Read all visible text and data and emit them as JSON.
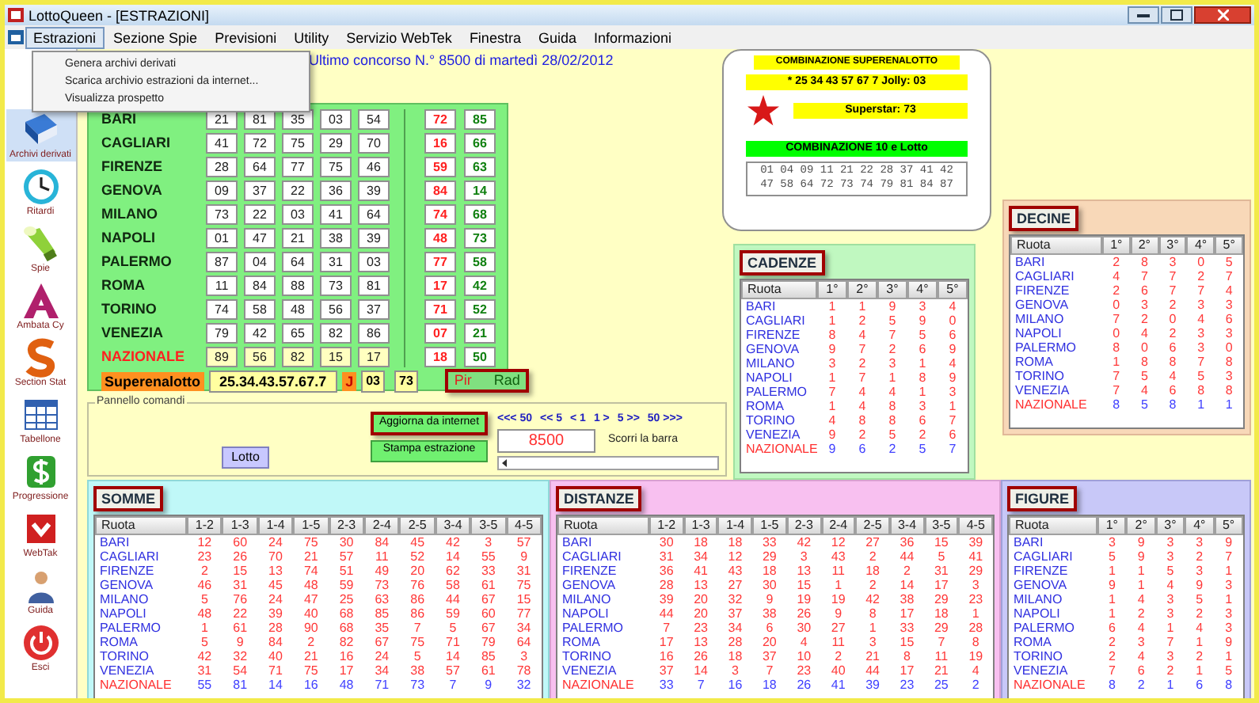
{
  "window": {
    "title": "LottoQueen - [ESTRAZIONI]"
  },
  "menu": [
    {
      "label": "Estrazioni",
      "selected": true
    },
    {
      "label": "Sezione Spie",
      "selected": false
    },
    {
      "label": "Previsioni",
      "selected": false
    },
    {
      "label": "Utility",
      "selected": false
    },
    {
      "label": "Servizio WebTek",
      "selected": false
    },
    {
      "label": "Finestra",
      "selected": false
    },
    {
      "label": "Guida",
      "selected": false
    },
    {
      "label": "Informazioni",
      "selected": false
    }
  ],
  "dropdown": [
    "Genera archivi derivati",
    "Scarica archivio estrazioni da internet...",
    "Visualizza prospetto"
  ],
  "sidebar": [
    {
      "label": "Archivi derivati",
      "kind": "book",
      "selected": true
    },
    {
      "label": "Ritardi",
      "kind": "clock",
      "selected": false
    },
    {
      "label": "Spie",
      "kind": "flashlight",
      "selected": false
    },
    {
      "label": "Ambata Cy",
      "kind": "triangle",
      "selected": false
    },
    {
      "label": "Section Stat",
      "kind": "curve",
      "selected": false
    },
    {
      "label": "Tabellone",
      "kind": "grid",
      "selected": false
    },
    {
      "label": "Progressione",
      "kind": "coin",
      "selected": false
    },
    {
      "label": "WebTak",
      "kind": "app",
      "selected": false
    },
    {
      "label": "Guida",
      "kind": "person",
      "selected": false
    },
    {
      "label": "Esci",
      "kind": "power",
      "selected": false
    }
  ],
  "heading": "Ultimo concorso N.° 8500 di martedì 28/02/2012",
  "wheels": [
    {
      "name": "BARI",
      "kind": "ruota",
      "numbers": [
        "21",
        "81",
        "35",
        "03",
        "54"
      ],
      "pir": "72",
      "rad": "85"
    },
    {
      "name": "CAGLIARI",
      "kind": "ruota",
      "numbers": [
        "41",
        "72",
        "75",
        "29",
        "70"
      ],
      "pir": "16",
      "rad": "66"
    },
    {
      "name": "FIRENZE",
      "kind": "ruota",
      "numbers": [
        "28",
        "64",
        "77",
        "75",
        "46"
      ],
      "pir": "59",
      "rad": "63"
    },
    {
      "name": "GENOVA",
      "kind": "ruota",
      "numbers": [
        "09",
        "37",
        "22",
        "36",
        "39"
      ],
      "pir": "84",
      "rad": "14"
    },
    {
      "name": "MILANO",
      "kind": "ruota",
      "numbers": [
        "73",
        "22",
        "03",
        "41",
        "64"
      ],
      "pir": "74",
      "rad": "68"
    },
    {
      "name": "NAPOLI",
      "kind": "ruota",
      "numbers": [
        "01",
        "47",
        "21",
        "38",
        "39"
      ],
      "pir": "48",
      "rad": "73"
    },
    {
      "name": "PALERMO",
      "kind": "ruota",
      "numbers": [
        "87",
        "04",
        "64",
        "31",
        "03"
      ],
      "pir": "77",
      "rad": "58"
    },
    {
      "name": "ROMA",
      "kind": "ruota",
      "numbers": [
        "11",
        "84",
        "88",
        "73",
        "81"
      ],
      "pir": "17",
      "rad": "42"
    },
    {
      "name": "TORINO",
      "kind": "ruota",
      "numbers": [
        "74",
        "58",
        "48",
        "56",
        "37"
      ],
      "pir": "71",
      "rad": "52"
    },
    {
      "name": "VENEZIA",
      "kind": "ruota",
      "numbers": [
        "79",
        "42",
        "65",
        "82",
        "86"
      ],
      "pir": "07",
      "rad": "21"
    },
    {
      "name": "NAZIONALE",
      "kind": "nazionale",
      "numbers": [
        "89",
        "56",
        "82",
        "15",
        "17"
      ],
      "pir": "18",
      "rad": "50"
    }
  ],
  "superenalotto": {
    "label": "Superenalotto",
    "combination": "25.34.43.57.67.7",
    "jolly_label": "J",
    "jolly": "03",
    "superstar": "73"
  },
  "pir_rad": {
    "pir": "Pir",
    "rad": "Rad",
    "highlighted": true
  },
  "combo_box": {
    "title": "COMBINAZIONE SUPERENALOTTO",
    "line": "* 25 34 43 57 67 7   Jolly: 03",
    "superstar": "Superstar: 73",
    "title_10": "COMBINAZIONE 10 e Lotto",
    "numbers": "01 04 09 11 21 22 28 37 41 42 47 58 64 72 73 74 79 81 84 87"
  },
  "panel": {
    "legend": "Pannello comandi",
    "lotto": "Lotto",
    "update": {
      "label": "Aggiorna da internet",
      "highlighted": true
    },
    "print": "Stampa estrazione",
    "nav": [
      "<<< 50",
      "<< 5",
      "< 1",
      "1 >",
      "5 >>",
      "50 >>>"
    ],
    "draw": "8500",
    "hint": "Scorri la barra"
  },
  "cadenze": {
    "title": "CADENZE",
    "highlighted": true,
    "columns": [
      "Ruota",
      "1°",
      "2°",
      "3°",
      "4°",
      "5°"
    ],
    "rows": [
      {
        "name": "BARI",
        "kind": "ruota",
        "values": [
          "1",
          "1",
          "9",
          "3",
          "4"
        ]
      },
      {
        "name": "CAGLIARI",
        "kind": "ruota",
        "values": [
          "1",
          "2",
          "5",
          "9",
          "0"
        ]
      },
      {
        "name": "FIRENZE",
        "kind": "ruota",
        "values": [
          "8",
          "4",
          "7",
          "5",
          "6"
        ]
      },
      {
        "name": "GENOVA",
        "kind": "ruota",
        "values": [
          "9",
          "7",
          "2",
          "6",
          "9"
        ]
      },
      {
        "name": "MILANO",
        "kind": "ruota",
        "values": [
          "3",
          "2",
          "3",
          "1",
          "4"
        ]
      },
      {
        "name": "NAPOLI",
        "kind": "ruota",
        "values": [
          "1",
          "7",
          "1",
          "8",
          "9"
        ]
      },
      {
        "name": "PALERMO",
        "kind": "ruota",
        "values": [
          "7",
          "4",
          "4",
          "1",
          "3"
        ]
      },
      {
        "name": "ROMA",
        "kind": "ruota",
        "values": [
          "1",
          "4",
          "8",
          "3",
          "1"
        ]
      },
      {
        "name": "TORINO",
        "kind": "ruota",
        "values": [
          "4",
          "8",
          "8",
          "6",
          "7"
        ]
      },
      {
        "name": "VENEZIA",
        "kind": "ruota",
        "values": [
          "9",
          "2",
          "5",
          "2",
          "6"
        ]
      },
      {
        "name": "NAZIONALE",
        "kind": "nazionale",
        "values": [
          "9",
          "6",
          "2",
          "5",
          "7"
        ]
      }
    ]
  },
  "decine": {
    "title": "DECINE",
    "highlighted": true,
    "columns": [
      "Ruota",
      "1°",
      "2°",
      "3°",
      "4°",
      "5°"
    ],
    "rows": [
      {
        "name": "BARI",
        "kind": "ruota",
        "values": [
          "2",
          "8",
          "3",
          "0",
          "5"
        ]
      },
      {
        "name": "CAGLIARI",
        "kind": "ruota",
        "values": [
          "4",
          "7",
          "7",
          "2",
          "7"
        ]
      },
      {
        "name": "FIRENZE",
        "kind": "ruota",
        "values": [
          "2",
          "6",
          "7",
          "7",
          "4"
        ]
      },
      {
        "name": "GENOVA",
        "kind": "ruota",
        "values": [
          "0",
          "3",
          "2",
          "3",
          "3"
        ]
      },
      {
        "name": "MILANO",
        "kind": "ruota",
        "values": [
          "7",
          "2",
          "0",
          "4",
          "6"
        ]
      },
      {
        "name": "NAPOLI",
        "kind": "ruota",
        "values": [
          "0",
          "4",
          "2",
          "3",
          "3"
        ]
      },
      {
        "name": "PALERMO",
        "kind": "ruota",
        "values": [
          "8",
          "0",
          "6",
          "3",
          "0"
        ]
      },
      {
        "name": "ROMA",
        "kind": "ruota",
        "values": [
          "1",
          "8",
          "8",
          "7",
          "8"
        ]
      },
      {
        "name": "TORINO",
        "kind": "ruota",
        "values": [
          "7",
          "5",
          "4",
          "5",
          "3"
        ]
      },
      {
        "name": "VENEZIA",
        "kind": "ruota",
        "values": [
          "7",
          "4",
          "6",
          "8",
          "8"
        ]
      },
      {
        "name": "NAZIONALE",
        "kind": "nazionale",
        "values": [
          "8",
          "5",
          "8",
          "1",
          "1"
        ]
      }
    ]
  },
  "somme": {
    "title": "SOMME",
    "highlighted": true,
    "columns": [
      "Ruota",
      "1-2",
      "1-3",
      "1-4",
      "1-5",
      "2-3",
      "2-4",
      "2-5",
      "3-4",
      "3-5",
      "4-5"
    ],
    "rows": [
      {
        "name": "BARI",
        "kind": "ruota",
        "values": [
          "12",
          "60",
          "24",
          "75",
          "30",
          "84",
          "45",
          "42",
          "3",
          "57"
        ]
      },
      {
        "name": "CAGLIARI",
        "kind": "ruota",
        "values": [
          "23",
          "26",
          "70",
          "21",
          "57",
          "11",
          "52",
          "14",
          "55",
          "9"
        ]
      },
      {
        "name": "FIRENZE",
        "kind": "ruota",
        "values": [
          "2",
          "15",
          "13",
          "74",
          "51",
          "49",
          "20",
          "62",
          "33",
          "31"
        ]
      },
      {
        "name": "GENOVA",
        "kind": "ruota",
        "values": [
          "46",
          "31",
          "45",
          "48",
          "59",
          "73",
          "76",
          "58",
          "61",
          "75"
        ]
      },
      {
        "name": "MILANO",
        "kind": "ruota",
        "values": [
          "5",
          "76",
          "24",
          "47",
          "25",
          "63",
          "86",
          "44",
          "67",
          "15"
        ]
      },
      {
        "name": "NAPOLI",
        "kind": "ruota",
        "values": [
          "48",
          "22",
          "39",
          "40",
          "68",
          "85",
          "86",
          "59",
          "60",
          "77"
        ]
      },
      {
        "name": "PALERMO",
        "kind": "ruota",
        "values": [
          "1",
          "61",
          "28",
          "90",
          "68",
          "35",
          "7",
          "5",
          "67",
          "34"
        ]
      },
      {
        "name": "ROMA",
        "kind": "ruota",
        "values": [
          "5",
          "9",
          "84",
          "2",
          "82",
          "67",
          "75",
          "71",
          "79",
          "64"
        ]
      },
      {
        "name": "TORINO",
        "kind": "ruota",
        "values": [
          "42",
          "32",
          "40",
          "21",
          "16",
          "24",
          "5",
          "14",
          "85",
          "3"
        ]
      },
      {
        "name": "VENEZIA",
        "kind": "ruota",
        "values": [
          "31",
          "54",
          "71",
          "75",
          "17",
          "34",
          "38",
          "57",
          "61",
          "78"
        ]
      },
      {
        "name": "NAZIONALE",
        "kind": "nazionale",
        "values": [
          "55",
          "81",
          "14",
          "16",
          "48",
          "71",
          "73",
          "7",
          "9",
          "32"
        ]
      }
    ]
  },
  "distanze": {
    "title": "DISTANZE",
    "highlighted": true,
    "columns": [
      "Ruota",
      "1-2",
      "1-3",
      "1-4",
      "1-5",
      "2-3",
      "2-4",
      "2-5",
      "3-4",
      "3-5",
      "4-5"
    ],
    "rows": [
      {
        "name": "BARI",
        "kind": "ruota",
        "values": [
          "30",
          "18",
          "18",
          "33",
          "42",
          "12",
          "27",
          "36",
          "15",
          "39"
        ]
      },
      {
        "name": "CAGLIARI",
        "kind": "ruota",
        "values": [
          "31",
          "34",
          "12",
          "29",
          "3",
          "43",
          "2",
          "44",
          "5",
          "41"
        ]
      },
      {
        "name": "FIRENZE",
        "kind": "ruota",
        "values": [
          "36",
          "41",
          "43",
          "18",
          "13",
          "11",
          "18",
          "2",
          "31",
          "29"
        ]
      },
      {
        "name": "GENOVA",
        "kind": "ruota",
        "values": [
          "28",
          "13",
          "27",
          "30",
          "15",
          "1",
          "2",
          "14",
          "17",
          "3"
        ]
      },
      {
        "name": "MILANO",
        "kind": "ruota",
        "values": [
          "39",
          "20",
          "32",
          "9",
          "19",
          "19",
          "42",
          "38",
          "29",
          "23"
        ]
      },
      {
        "name": "NAPOLI",
        "kind": "ruota",
        "values": [
          "44",
          "20",
          "37",
          "38",
          "26",
          "9",
          "8",
          "17",
          "18",
          "1"
        ]
      },
      {
        "name": "PALERMO",
        "kind": "ruota",
        "values": [
          "7",
          "23",
          "34",
          "6",
          "30",
          "27",
          "1",
          "33",
          "29",
          "28"
        ]
      },
      {
        "name": "ROMA",
        "kind": "ruota",
        "values": [
          "17",
          "13",
          "28",
          "20",
          "4",
          "11",
          "3",
          "15",
          "7",
          "8"
        ]
      },
      {
        "name": "TORINO",
        "kind": "ruota",
        "values": [
          "16",
          "26",
          "18",
          "37",
          "10",
          "2",
          "21",
          "8",
          "11",
          "19"
        ]
      },
      {
        "name": "VENEZIA",
        "kind": "ruota",
        "values": [
          "37",
          "14",
          "3",
          "7",
          "23",
          "40",
          "44",
          "17",
          "21",
          "4"
        ]
      },
      {
        "name": "NAZIONALE",
        "kind": "nazionale",
        "values": [
          "33",
          "7",
          "16",
          "18",
          "26",
          "41",
          "39",
          "23",
          "25",
          "2"
        ]
      }
    ]
  },
  "figure": {
    "title": "FIGURE",
    "highlighted": true,
    "columns": [
      "Ruota",
      "1°",
      "2°",
      "3°",
      "4°",
      "5°"
    ],
    "rows": [
      {
        "name": "BARI",
        "kind": "ruota",
        "values": [
          "3",
          "9",
          "3",
          "3",
          "9"
        ]
      },
      {
        "name": "CAGLIARI",
        "kind": "ruota",
        "values": [
          "5",
          "9",
          "3",
          "2",
          "7"
        ]
      },
      {
        "name": "FIRENZE",
        "kind": "ruota",
        "values": [
          "1",
          "1",
          "5",
          "3",
          "1"
        ]
      },
      {
        "name": "GENOVA",
        "kind": "ruota",
        "values": [
          "9",
          "1",
          "4",
          "9",
          "3"
        ]
      },
      {
        "name": "MILANO",
        "kind": "ruota",
        "values": [
          "1",
          "4",
          "3",
          "5",
          "1"
        ]
      },
      {
        "name": "NAPOLI",
        "kind": "ruota",
        "values": [
          "1",
          "2",
          "3",
          "2",
          "3"
        ]
      },
      {
        "name": "PALERMO",
        "kind": "ruota",
        "values": [
          "6",
          "4",
          "1",
          "4",
          "3"
        ]
      },
      {
        "name": "ROMA",
        "kind": "ruota",
        "values": [
          "2",
          "3",
          "7",
          "1",
          "9"
        ]
      },
      {
        "name": "TORINO",
        "kind": "ruota",
        "values": [
          "2",
          "4",
          "3",
          "2",
          "1"
        ]
      },
      {
        "name": "VENEZIA",
        "kind": "ruota",
        "values": [
          "7",
          "6",
          "2",
          "1",
          "5"
        ]
      },
      {
        "name": "NAZIONALE",
        "kind": "nazionale",
        "values": [
          "8",
          "2",
          "1",
          "6",
          "8"
        ]
      }
    ]
  }
}
